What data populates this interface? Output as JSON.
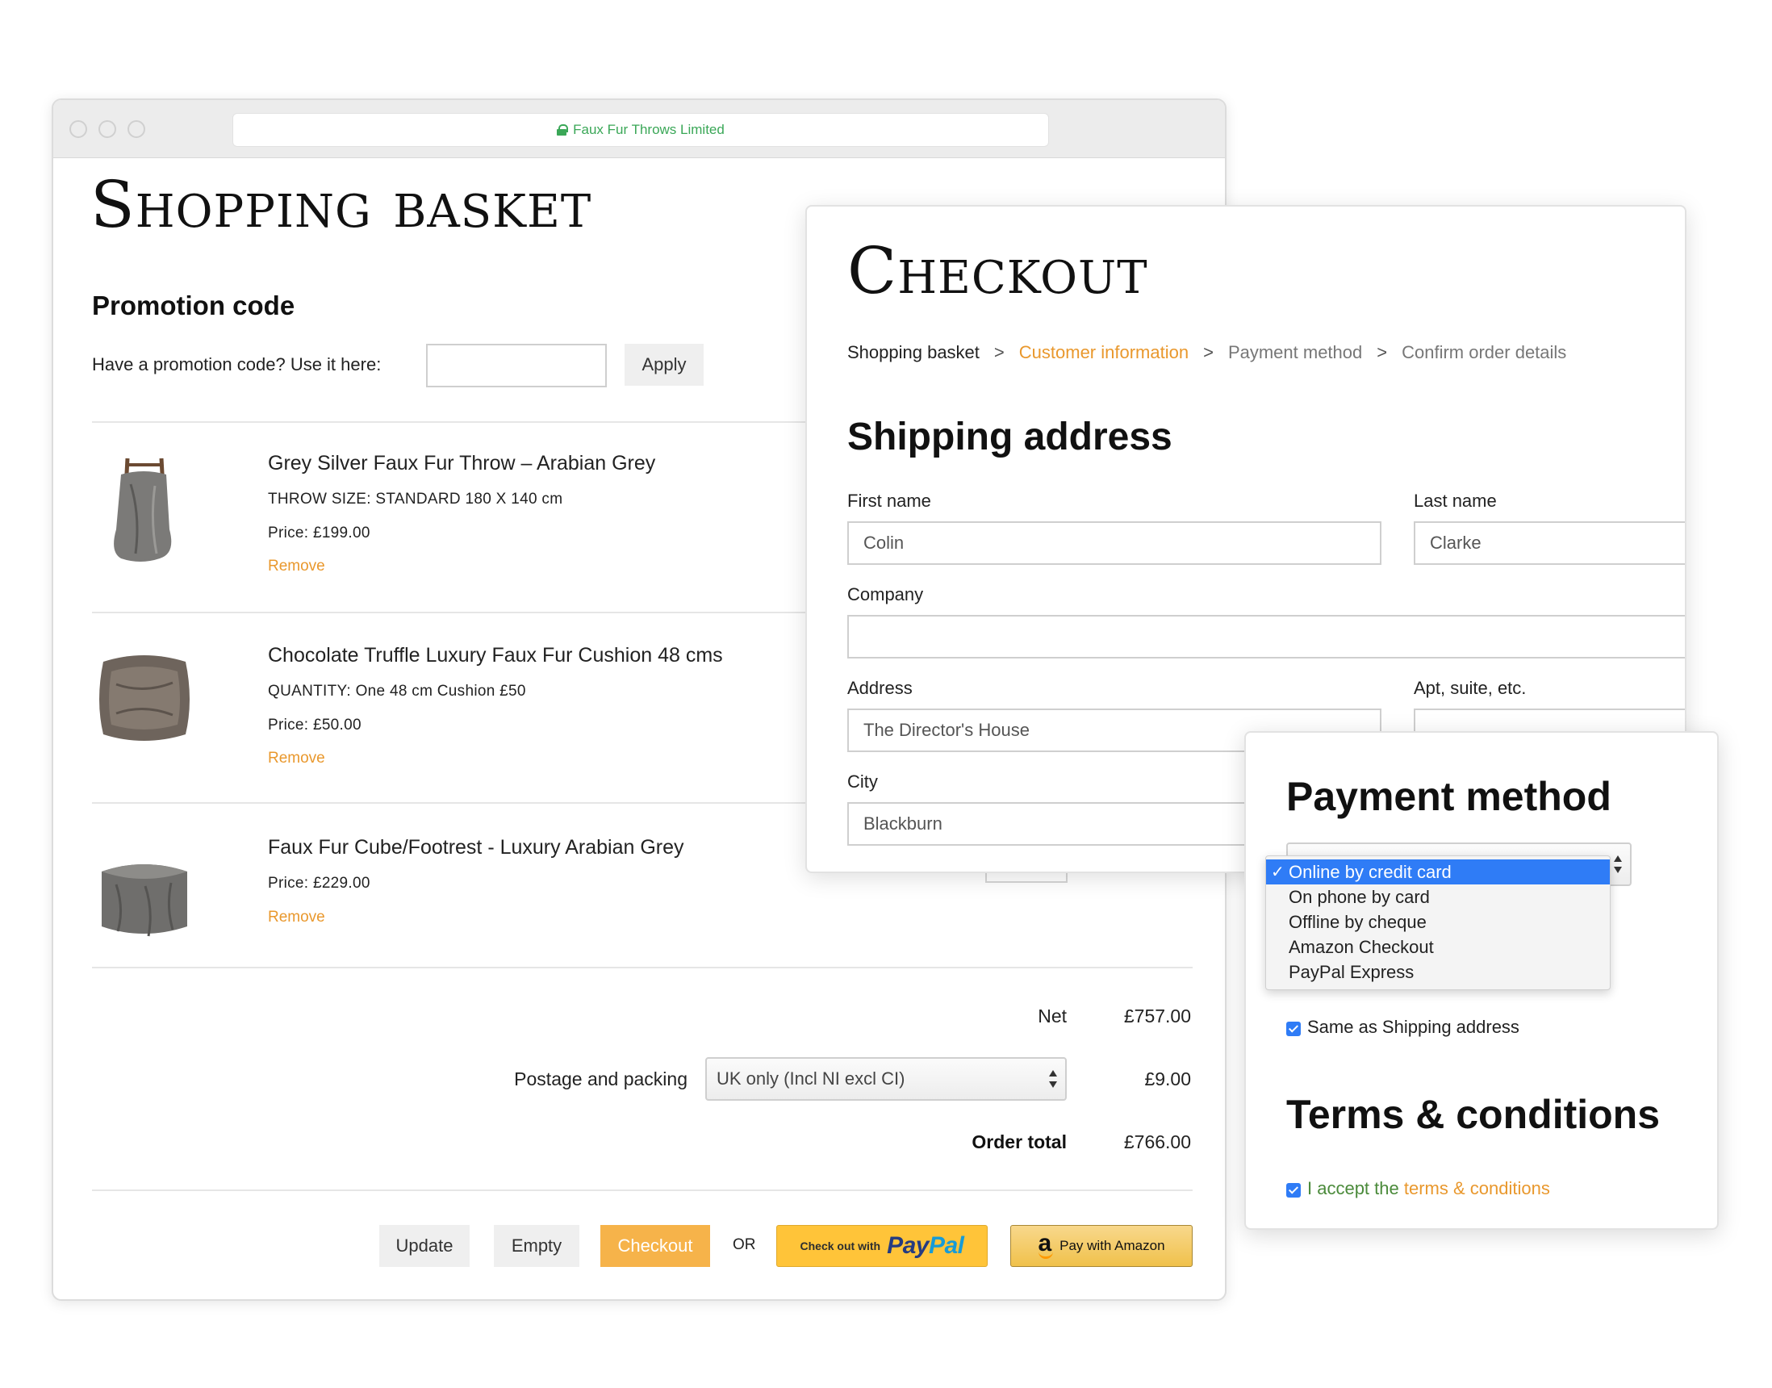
{
  "browser": {
    "url_title": "Faux Fur Throws Limited"
  },
  "basket": {
    "title": "Shopping basket",
    "promo": {
      "heading": "Promotion code",
      "label": "Have a promotion code? Use it here:",
      "value": "",
      "apply_label": "Apply"
    },
    "items": [
      {
        "name": "Grey Silver Faux Fur Throw – Arabian Grey",
        "meta": [
          "THROW SIZE: STANDARD 180 X 140 cm",
          "Price: £199.00"
        ],
        "remove_label": "Remove",
        "thumb_icon": "throw-on-ladder-image"
      },
      {
        "name": "Chocolate Truffle Luxury Faux Fur Cushion 48 cms",
        "meta": [
          "QUANTITY: One 48 cm Cushion £50",
          "Price: £50.00"
        ],
        "remove_label": "Remove",
        "thumb_icon": "cushion-image"
      },
      {
        "name": "Faux Fur Cube/Footrest - Luxury Arabian Grey",
        "meta": [
          "Price: £229.00"
        ],
        "remove_label": "Remove",
        "thumb_icon": "footrest-cube-image"
      }
    ],
    "totals": {
      "net_label": "Net",
      "net_value": "£757.00",
      "postage_label": "Postage and packing",
      "postage_option": "UK only (Incl NI excl CI)",
      "postage_value": "£9.00",
      "total_label": "Order total",
      "total_value": "£766.00"
    },
    "actions": {
      "update_label": "Update",
      "empty_label": "Empty",
      "checkout_label": "Checkout",
      "or_label": "OR",
      "paypal_small": "Check out with",
      "paypal_brand_1": "Pay",
      "paypal_brand_2": "Pal",
      "amazon_label": "Pay with Amazon"
    }
  },
  "checkout": {
    "title": "Checkout",
    "breadcrumb": {
      "step1": "Shopping basket",
      "step2": "Customer information",
      "step3": "Payment method",
      "step4": "Confirm order details",
      "separator": ">"
    },
    "shipping_heading": "Shipping address",
    "fields": {
      "first_name_label": "First name",
      "first_name_value": "Colin",
      "last_name_label": "Last name",
      "last_name_value": "Clarke",
      "company_label": "Company",
      "company_value": "",
      "address_label": "Address",
      "address_value": "The Director's House",
      "apt_label": "Apt, suite, etc.",
      "apt_value": "",
      "city_label": "City",
      "city_value": "Blackburn"
    }
  },
  "payment": {
    "heading": "Payment method",
    "options": [
      "Online by credit card",
      "On phone by card",
      "Offline by cheque",
      "Amazon Checkout",
      "PayPal Express"
    ],
    "selected_index": 0,
    "check_glyph": "✓",
    "same_as_shipping_label": "Same as Shipping address",
    "same_as_shipping_checked": true,
    "terms_heading": "Terms & conditions",
    "accept_prefix": "I accept the",
    "terms_link": "terms & conditions",
    "accept_checked": true
  },
  "colors": {
    "accent_orange": "#e9982d",
    "checkout_button": "#f6b34a",
    "select_highlight": "#2f7cf6",
    "secure_green": "#3aa757"
  }
}
